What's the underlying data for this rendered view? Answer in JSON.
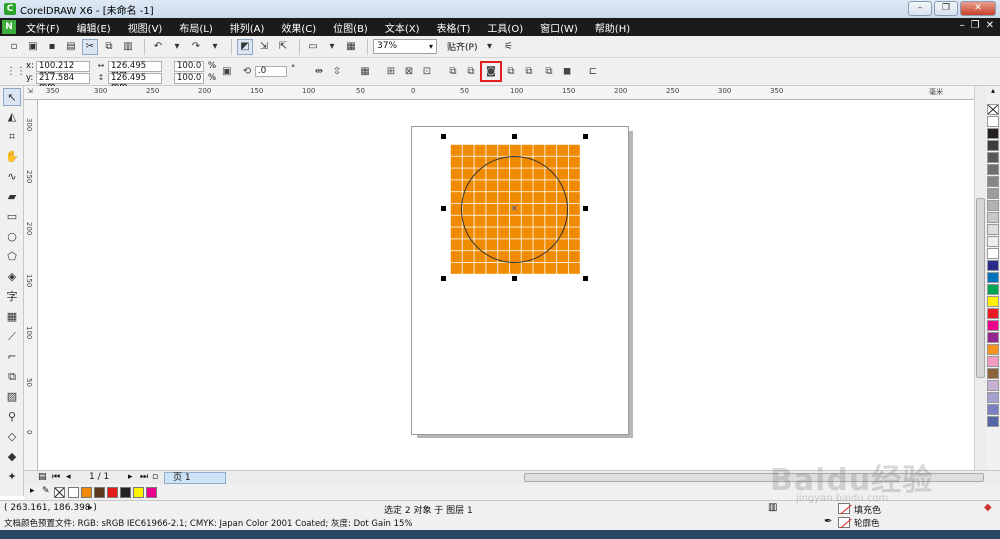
{
  "window": {
    "title": "CorelDRAW X6 - [未命名 -1]"
  },
  "menu": {
    "items": [
      "文件(F)",
      "编辑(E)",
      "视图(V)",
      "布局(L)",
      "排列(A)",
      "效果(C)",
      "位图(B)",
      "文本(X)",
      "表格(T)",
      "工具(O)",
      "窗口(W)",
      "帮助(H)"
    ]
  },
  "standard_toolbar": {
    "zoom": "37%",
    "snap_label": "贴齐(P)"
  },
  "property_bar": {
    "x_label": "x:",
    "x_value": "100.212 mm",
    "y_label": "y:",
    "y_value": "217.584 mm",
    "width": "126.495 mm",
    "height": "126.495 mm",
    "scale_w": "100.0",
    "scale_h": "100.0",
    "pct": "%",
    "angle": ".0",
    "degree": "°"
  },
  "ruler": {
    "h_ticks": [
      "350",
      "300",
      "250",
      "200",
      "150",
      "100",
      "50",
      "0",
      "50",
      "100",
      "150",
      "200",
      "250",
      "300",
      "350"
    ],
    "v_ticks": [
      "300",
      "250",
      "200",
      "150",
      "100",
      "50",
      "0"
    ],
    "unit": "毫米"
  },
  "page_nav": {
    "count": "1 / 1",
    "tab": "页 1"
  },
  "status": {
    "coords": "( 263.161, 186.398 )",
    "selection": "选定 2 对象 于 图层 1",
    "color_profile": "文档颜色预置文件: RGB: sRGB IEC61966-2.1; CMYK: Japan Color 2001 Coated; 灰度: Dot Gain 15%",
    "fill_label": "填充色",
    "outline_label": "轮廓色"
  },
  "palette_colors": [
    "#ffffff",
    "#231f20",
    "#3b3b3b",
    "#575757",
    "#6f6f6f",
    "#868686",
    "#9c9c9c",
    "#b2b2b2",
    "#c8c8c8",
    "#dcdcdc",
    "#eeeeee",
    "#ffffff",
    "#2a2a8c",
    "#0072bc",
    "#00a651",
    "#fff200",
    "#ed1c24",
    "#ec008c",
    "#92278f",
    "#f7941d",
    "#f49ac1",
    "#8c6239",
    "#c7b2d6",
    "#a3a0d0",
    "#7b7fc2",
    "#5566a8"
  ],
  "doc_palette": [
    "#ffffff",
    "#f08a00",
    "#5a3a1a",
    "#e31b1b",
    "#222222",
    "#fff200",
    "#ec008c"
  ],
  "watermark": {
    "text": "Baidu经验",
    "sub": "jingyan.baidu.com"
  },
  "colors": {
    "shape_fill": "#f08a00",
    "highlight": "#e02020"
  }
}
